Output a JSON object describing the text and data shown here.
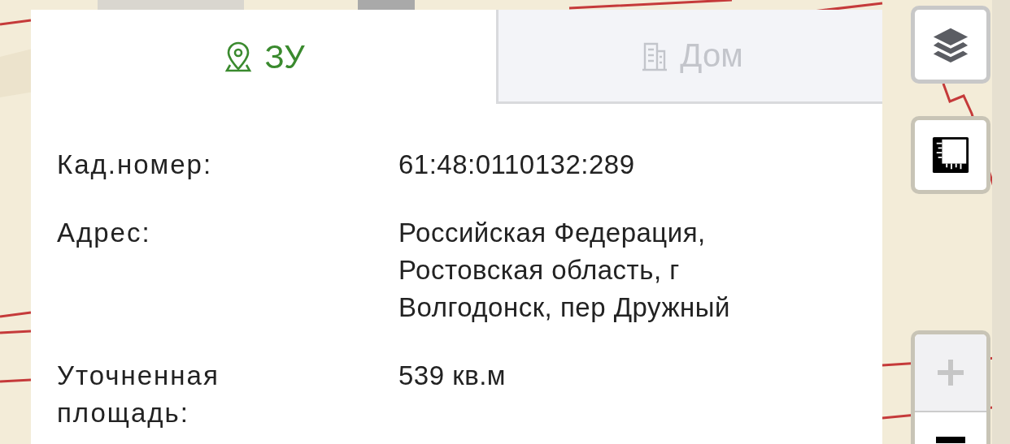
{
  "tabs": [
    {
      "label": "ЗУ",
      "kind": "plot",
      "selected": true
    },
    {
      "label": "Дом",
      "kind": "building",
      "selected": false
    }
  ],
  "fields": [
    {
      "label": "Кад.номер:",
      "value": "61:48:0110132:289"
    },
    {
      "label": "Адрес:",
      "value": "Российская Федерация, Ростовская область, г Волгодонск, пер Дружный"
    },
    {
      "label": "Уточненная площадь:",
      "value": "539 кв.м"
    }
  ],
  "map_controls": {
    "zoom_in_disabled": true
  }
}
